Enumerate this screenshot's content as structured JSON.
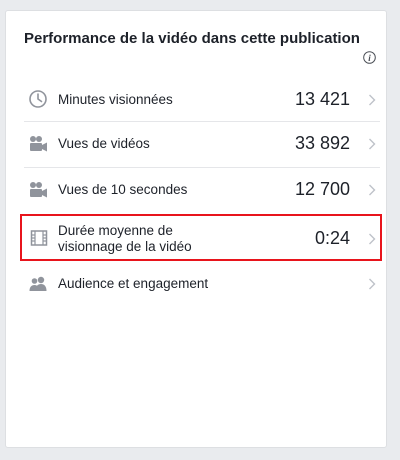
{
  "card": {
    "title": "Performance de la vidéo dans cette publication",
    "info_icon": "info-icon"
  },
  "metrics": [
    {
      "label": "Minutes visionnées",
      "value": "13 421",
      "icon": "clock-icon"
    },
    {
      "label": "Vues de vidéos",
      "value": "33 892",
      "icon": "video-camera-icon"
    },
    {
      "label": "Vues de 10 secondes",
      "value": "12 700",
      "icon": "video-camera-icon"
    },
    {
      "label_line1": "Durée moyenne de",
      "label_line2": "visionnage de la vidéo",
      "value": "0:24",
      "icon": "film-strip-icon",
      "highlighted": true
    },
    {
      "label": "Audience et engagement",
      "value": "",
      "icon": "people-icon"
    }
  ],
  "colors": {
    "highlight_border": "#e8141c",
    "icon_gray": "#90949c",
    "text": "#1d2129"
  }
}
